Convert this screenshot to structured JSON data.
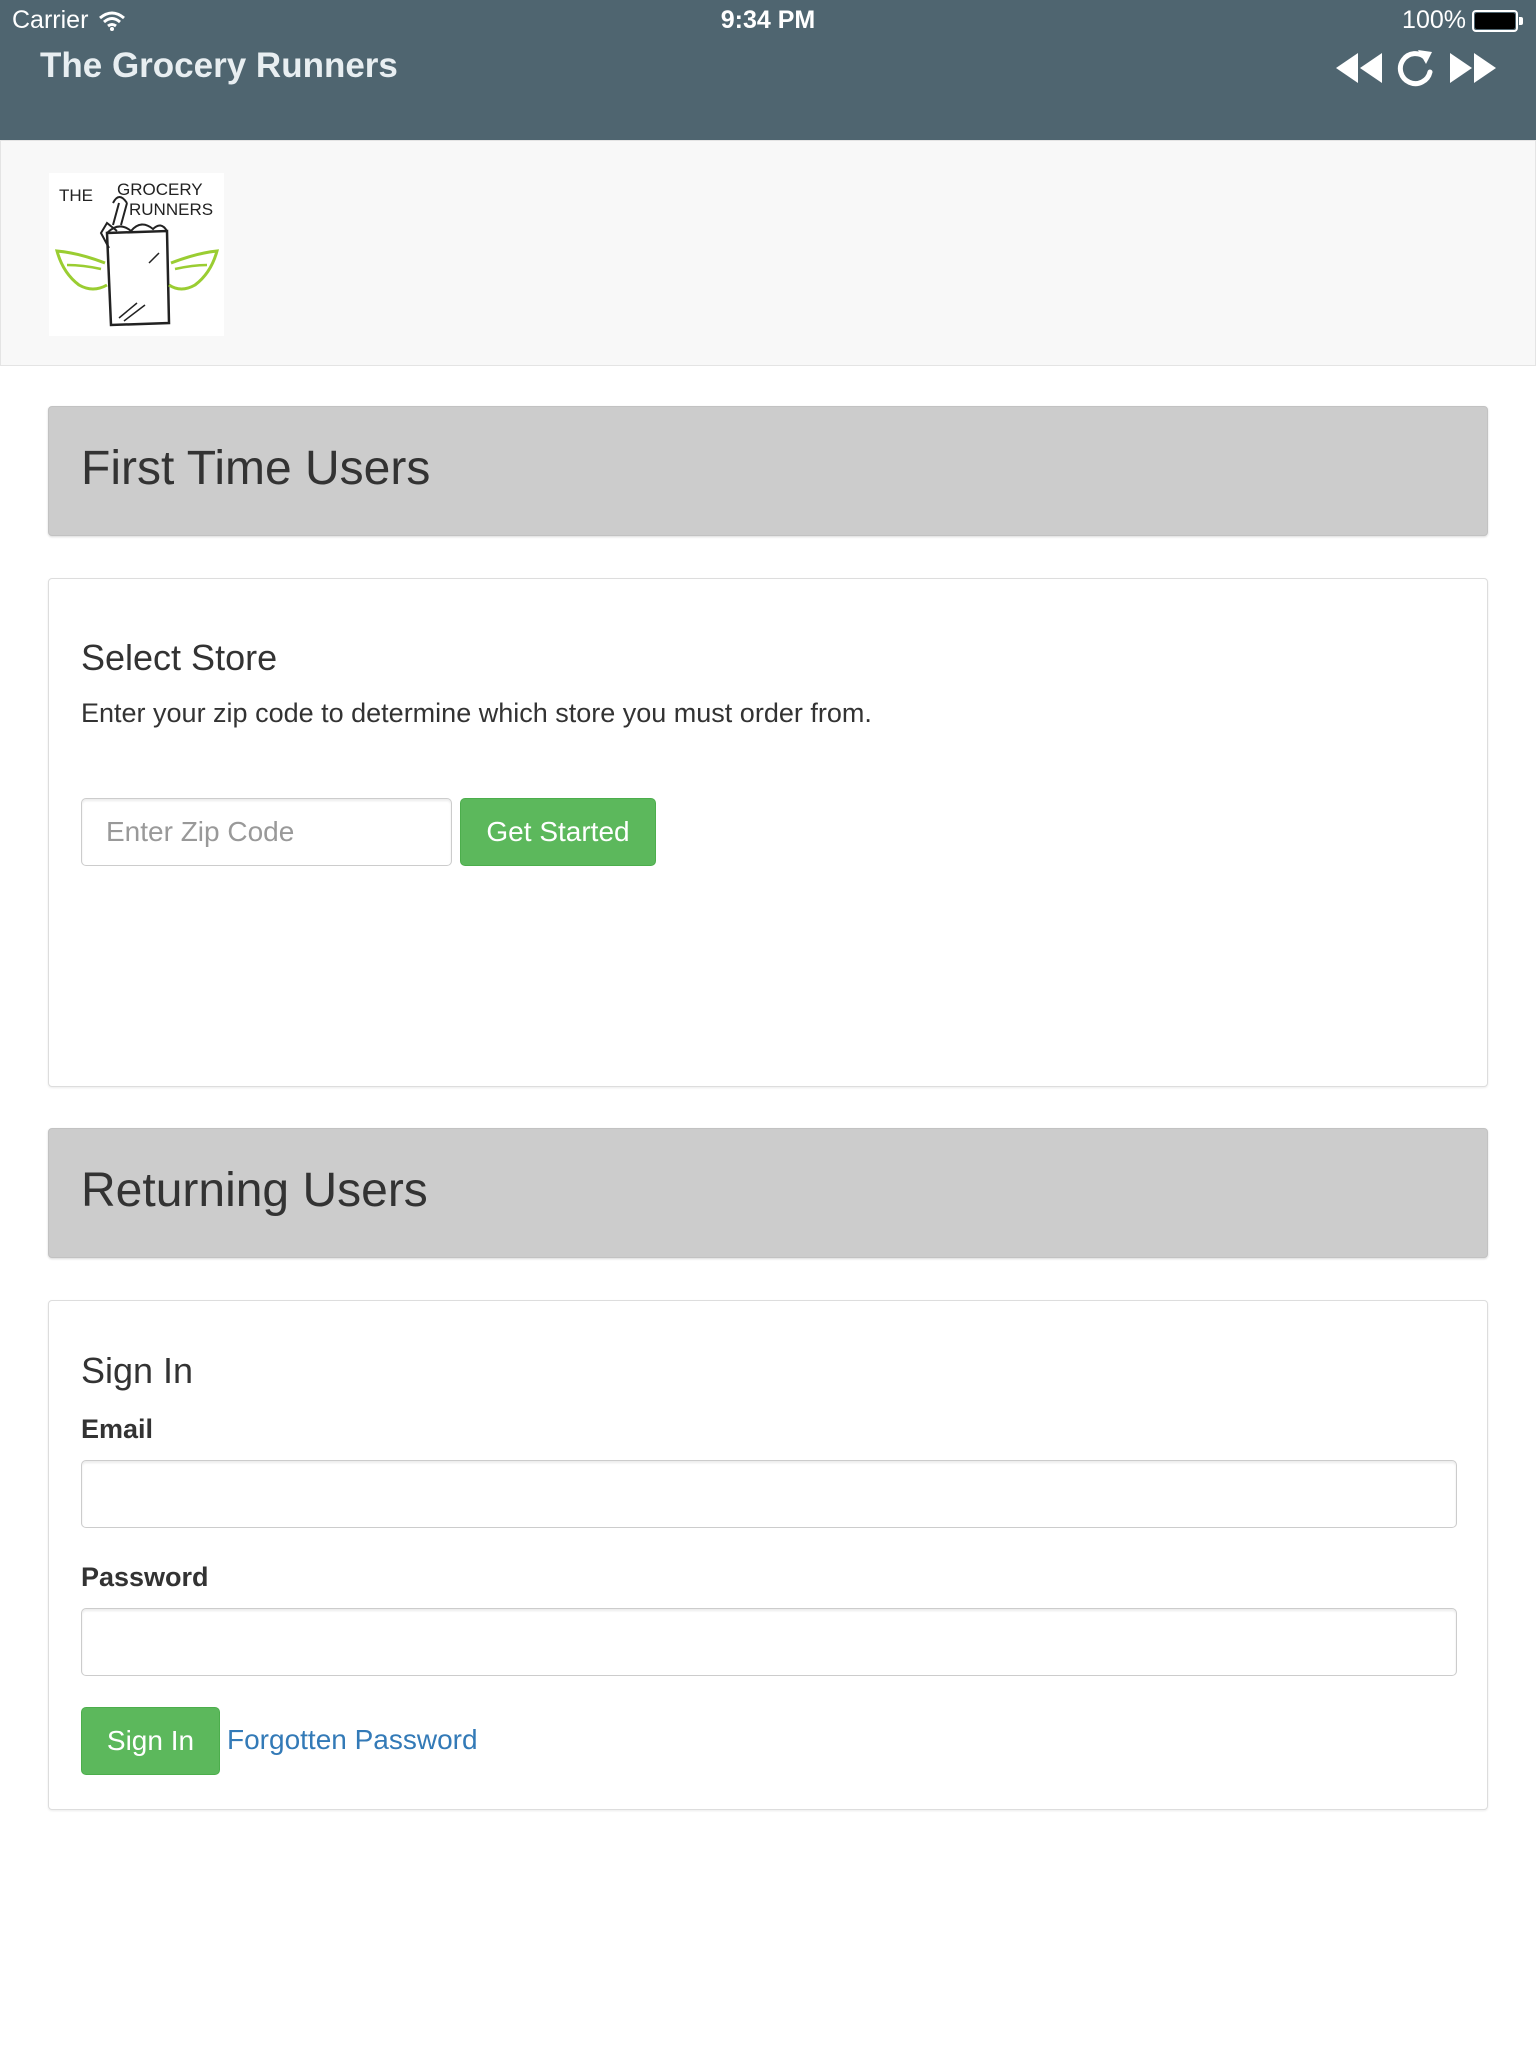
{
  "status_bar": {
    "carrier": "Carrier",
    "time": "9:34 PM",
    "battery": "100%"
  },
  "app_bar": {
    "title": "The Grocery Runners",
    "icons": [
      "rewind-icon",
      "refresh-icon",
      "fast-forward-icon"
    ],
    "background": "#4f6570"
  },
  "logo": {
    "line1": "THE",
    "line2": "GROCERY",
    "line3": "RUNNERS"
  },
  "first_time": {
    "heading": "First Time Users",
    "title": "Select Store",
    "description": "Enter your zip code to determine which store you must order from.",
    "zip_placeholder": "Enter Zip Code",
    "zip_value": "",
    "get_started_label": "Get Started"
  },
  "returning": {
    "heading": "Returning Users",
    "title": "Sign In",
    "email_label": "Email",
    "email_value": "",
    "password_label": "Password",
    "password_value": "",
    "sign_in_label": "Sign In",
    "forgot_label": "Forgotten Password"
  },
  "colors": {
    "accent_green": "#5cb85c",
    "link_blue": "#337ab7",
    "panel_heading_bg": "#cccccc"
  }
}
